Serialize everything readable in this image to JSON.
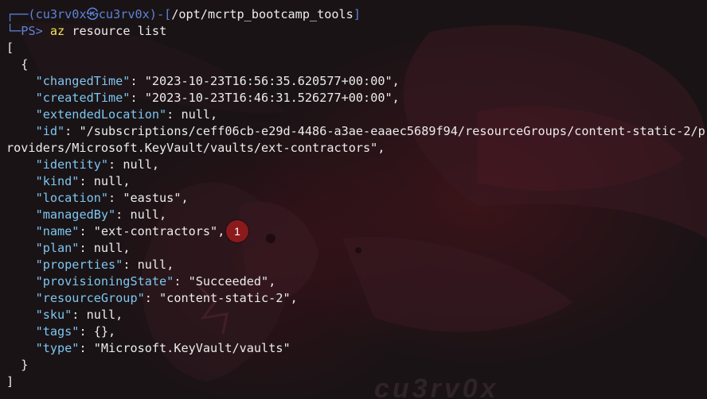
{
  "prompt": {
    "corner_top": "┌──(",
    "user": "cu3rv0x",
    "at_symbol": "㉿",
    "host": "cu3rv0x",
    "bracket_mid": ")-[",
    "path": "/opt/mcrtp_bootcamp_tools",
    "bracket_end": "]",
    "corner_bottom": "└─",
    "ps_label": "PS>",
    "command": "az",
    "args": "resource list"
  },
  "output": {
    "open_bracket": "[",
    "open_brace": "{",
    "fields": [
      {
        "key": "\"changedTime\"",
        "value": "\"2023-10-23T16:56:35.620577+00:00\"",
        "sep": ","
      },
      {
        "key": "\"createdTime\"",
        "value": "\"2023-10-23T16:46:31.526277+00:00\"",
        "sep": ","
      },
      {
        "key": "\"extendedLocation\"",
        "value": "null",
        "sep": ","
      },
      {
        "key": "\"id\"",
        "value": "\"/subscriptions/ceff06cb-e29d-4486-a3ae-eaaec5689f94/resourceGroups/content-static-2/p",
        "sep": ""
      },
      {
        "key": "",
        "value": "roviders/Microsoft.KeyVault/vaults/ext-contractors\"",
        "sep": ",",
        "continuation": true
      },
      {
        "key": "\"identity\"",
        "value": "null",
        "sep": ","
      },
      {
        "key": "\"kind\"",
        "value": "null",
        "sep": ","
      },
      {
        "key": "\"location\"",
        "value": "\"eastus\"",
        "sep": ","
      },
      {
        "key": "\"managedBy\"",
        "value": "null",
        "sep": ","
      },
      {
        "key": "\"name\"",
        "value": "\"ext-contractors\"",
        "sep": ","
      },
      {
        "key": "\"plan\"",
        "value": "null",
        "sep": ","
      },
      {
        "key": "\"properties\"",
        "value": "null",
        "sep": ","
      },
      {
        "key": "\"provisioningState\"",
        "value": "\"Succeeded\"",
        "sep": ","
      },
      {
        "key": "\"resourceGroup\"",
        "value": "\"content-static-2\"",
        "sep": ","
      },
      {
        "key": "\"sku\"",
        "value": "null",
        "sep": ","
      },
      {
        "key": "\"tags\"",
        "value": "{}",
        "sep": ","
      },
      {
        "key": "\"type\"",
        "value": "\"Microsoft.KeyVault/vaults\"",
        "sep": ""
      }
    ],
    "close_brace": "}",
    "close_bracket": "]"
  },
  "annotation": {
    "marker_label": "1"
  },
  "wallpaper": {
    "watermark": "cu3rv0x"
  },
  "colors": {
    "background": "#1a1316",
    "json_key": "#7cc6ef",
    "json_value": "#ececec",
    "prompt_blue": "#5c84d6",
    "command_yellow": "#f5e35a",
    "marker_red": "#8b1a1c"
  }
}
